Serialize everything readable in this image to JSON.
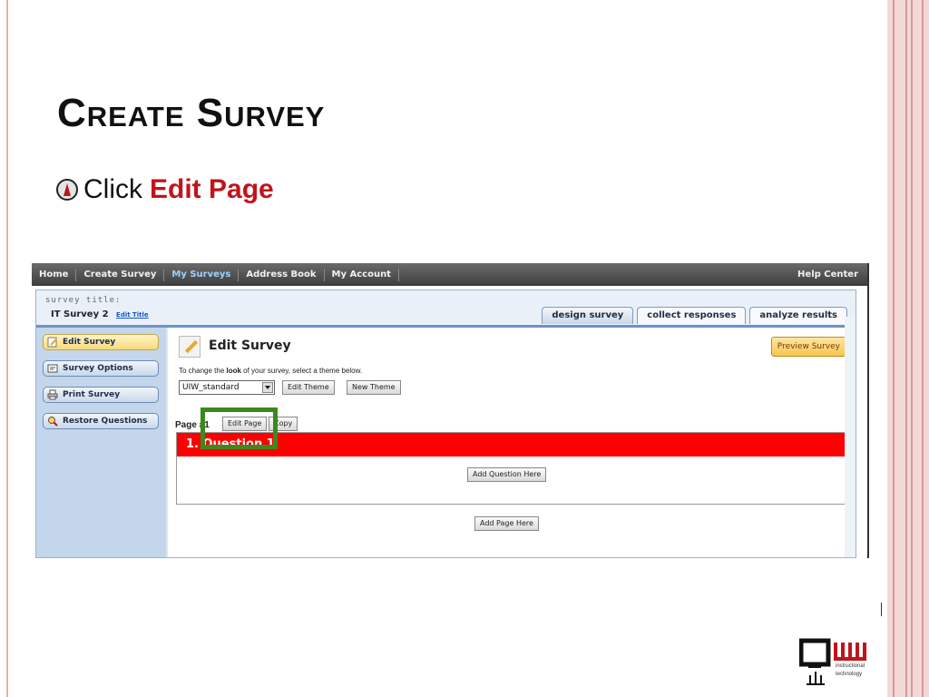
{
  "slide": {
    "title": "Create Survey",
    "bullet_prefix": "Click",
    "bullet_emphasis": "Edit Page"
  },
  "nav": {
    "items": [
      "Home",
      "Create Survey",
      "My Surveys",
      "Address Book",
      "My Account"
    ],
    "active": "My Surveys",
    "help": "Help Center"
  },
  "survey": {
    "title_label": "survey title:",
    "name": "IT Survey 2",
    "edit_title": "Edit Title"
  },
  "tabs": [
    "design survey",
    "collect responses",
    "analyze results"
  ],
  "sidebar": {
    "items": [
      "Edit Survey",
      "Survey Options",
      "Print Survey",
      "Restore Questions"
    ]
  },
  "main": {
    "heading": "Edit Survey",
    "preview_button": "Preview Survey",
    "theme_text_before": "To change the ",
    "theme_text_bold": "look",
    "theme_text_after": " of your survey, select a theme below.",
    "theme_value": "UIW_standard",
    "edit_theme": "Edit Theme",
    "new_theme": "New Theme",
    "page_label": "Page #1",
    "edit_page": "Edit Page",
    "copy": "Copy",
    "question": "1. Question 1",
    "add_question": "Add Question Here",
    "add_page": "Add Page Here"
  },
  "logo": {
    "line1": "instructional",
    "line2": "technology"
  },
  "colors": {
    "accent_red": "#c0141b",
    "question_red": "#ff0000",
    "highlight_green": "#3a8a1e"
  }
}
